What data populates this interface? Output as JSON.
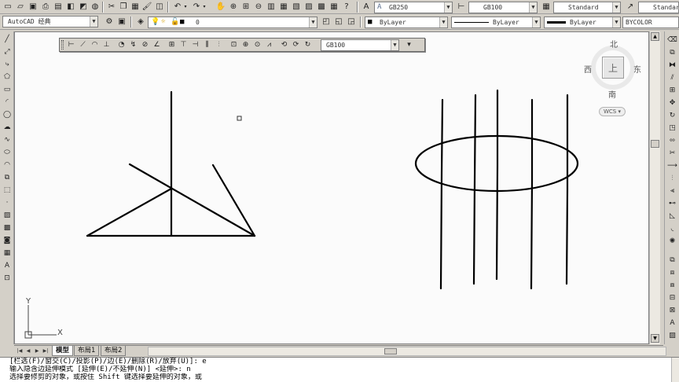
{
  "toolbar": {
    "dimstyle_combo": "GB250",
    "textstyle_combo": "GB100",
    "tablestyle_combo": "Standard",
    "mleaderstyle_combo": "Standard",
    "workspace_combo": "AutoCAD 经典",
    "layer_combo": "0",
    "color_combo": "ByLayer",
    "linetype_combo": "ByLayer",
    "lineweight_combo": "ByLayer",
    "plotstyle_combo": "BYCOLOR"
  },
  "dim_toolbar": {
    "dimstyle_combo": "GB100"
  },
  "viewcube": {
    "north": "北",
    "south": "南",
    "east": "东",
    "west": "西",
    "face": "上",
    "wcs": "WCS"
  },
  "ucs": {
    "x_label": "X",
    "y_label": "Y"
  },
  "tabs": {
    "model": "模型",
    "layout1": "布局1",
    "layout2": "布局2"
  },
  "command": {
    "line1": "[栏选(F)/窗交(C)/投影(P)/边(E)/删除(R)/放弃(U)]:  e",
    "line2": "输入隐含边延伸模式 [延伸(E)/不延伸(N)] <延伸>: n",
    "line3": "选择要修剪的对象，或按住 Shift 键选择要延伸的对象，或"
  },
  "colors": {
    "canvas": "#fbfbfb",
    "chrome": "#d4d0c8",
    "stroke": "#000000"
  }
}
